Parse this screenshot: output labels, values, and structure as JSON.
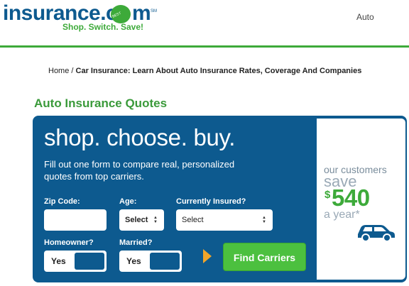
{
  "header": {
    "logo_text": "insurance.c",
    "logo_m": "m",
    "logo_o_text": "BEST RATES",
    "logo_tm": "SM",
    "tagline": "Shop. Switch. Save!",
    "nav_item": "Auto"
  },
  "breadcrumb": {
    "home": "Home",
    "separator": " / ",
    "current": "Car Insurance: Learn About Auto Insurance Rates, Coverage And Companies"
  },
  "section_title": "Auto Insurance Quotes",
  "widget": {
    "headline": "shop. choose. buy.",
    "subtext": "Fill out one form to compare real, personalized quotes from top carriers.",
    "zip_label": "Zip Code:",
    "zip_value": "",
    "age_label": "Age:",
    "age_value": "Select",
    "insured_label": "Currently Insured?",
    "insured_value": "Select",
    "homeowner_label": "Homeowner?",
    "homeowner_value": "Yes",
    "married_label": "Married?",
    "married_value": "Yes",
    "find_button": "Find Carriers"
  },
  "promo": {
    "line1": "our customers",
    "save": "save",
    "dollar": "$",
    "amount": "540",
    "per": "a year*"
  },
  "colors": {
    "brand_blue": "#0d5a8f",
    "brand_green": "#3daa3a",
    "button_green": "#4cc03f",
    "arrow_orange": "#f0a52a"
  },
  "icons": [
    "select-arrows-icon",
    "play-arrow-icon",
    "car-icon"
  ]
}
